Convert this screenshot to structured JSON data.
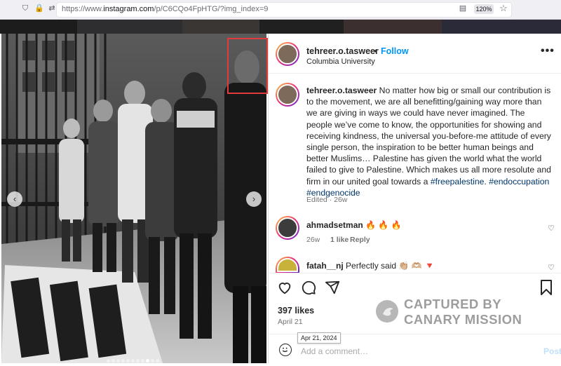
{
  "browser": {
    "url_prefix": "https://www.",
    "url_domain": "instagram.com",
    "url_path": "/p/C6CQo4FpHTG/?img_index=9",
    "zoom": "120%"
  },
  "post": {
    "username": "tehreer.o.tasweer",
    "separator": "•",
    "follow_label": "Follow",
    "location": "Columbia University",
    "more_label": "•••",
    "caption_username": "tehreer.o.tasweer",
    "caption_text": "No matter how big or small our contribution is to the movement, we are all benefitting/gaining way more than we are giving in ways we could have never imagined. The people we’ve come to know, the opportunities for showing and receiving kindness, the universal you-before-me attitude of every single person, the inspiration to be better human beings and better Muslims… Palestine has given the world what the world failed to give to Palestine. Which makes us all more resolute and firm in our united goal towards a",
    "hashtag_1": "#freepalestine",
    "hashtag_2": "#endoccupation",
    "hashtag_3": "#endgenocide",
    "caption_meta": "Edited · 26w",
    "likes": "397 likes",
    "date": "April 21",
    "date_tooltip": "Apr 21, 2024",
    "add_comment_placeholder": "Add a comment…",
    "post_label": "Post"
  },
  "comments": [
    {
      "username": "ahmadsetman",
      "text": "🔥 🔥 🔥",
      "age": "26w",
      "likes": "1 like",
      "reply_label": "Reply"
    },
    {
      "username": "fatah__nj",
      "text": "Perfectly said 👏🏼 🫶🏼 🔻"
    }
  ],
  "watermark": {
    "line1": "CAPTURED BY",
    "line2": "CANARY MISSION"
  },
  "colors": {
    "follow_blue": "#0095f6",
    "hashtag_blue": "#00376b",
    "highlight_red": "#e23b3b",
    "watermark_gray": "#9d9d9d"
  },
  "carousel": {
    "slide_count": 11,
    "current_slide": 9
  }
}
